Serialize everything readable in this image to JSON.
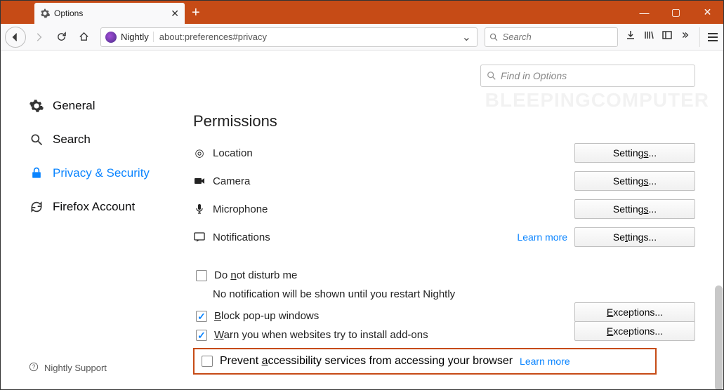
{
  "titlebar": {
    "tab_label": "Options",
    "newtab_glyph": "+"
  },
  "toolbar": {
    "nightly_label": "Nightly",
    "url": "about:preferences#privacy",
    "search_placeholder": "Search"
  },
  "watermark": "BLEEPINGCOMPUTER",
  "find_placeholder": "Find in Options",
  "sidebar": {
    "general": "General",
    "search": "Search",
    "privacy": "Privacy & Security",
    "account": "Firefox Account",
    "support": "Nightly Support"
  },
  "permissions": {
    "heading": "Permissions",
    "location": "Location",
    "camera": "Camera",
    "microphone": "Microphone",
    "notifications": "Notifications",
    "learn_more": "Learn more",
    "settings_btn": "Settings...",
    "exceptions_btn": "Exceptions...",
    "dnd": "Do not disturb me",
    "dnd_note": "No notification will be shown until you restart Nightly",
    "block_popups": "Block pop-up windows",
    "warn_install": "Warn you when websites try to install add-ons",
    "prevent_a11y": "Prevent accessibility services from accessing your browser"
  }
}
